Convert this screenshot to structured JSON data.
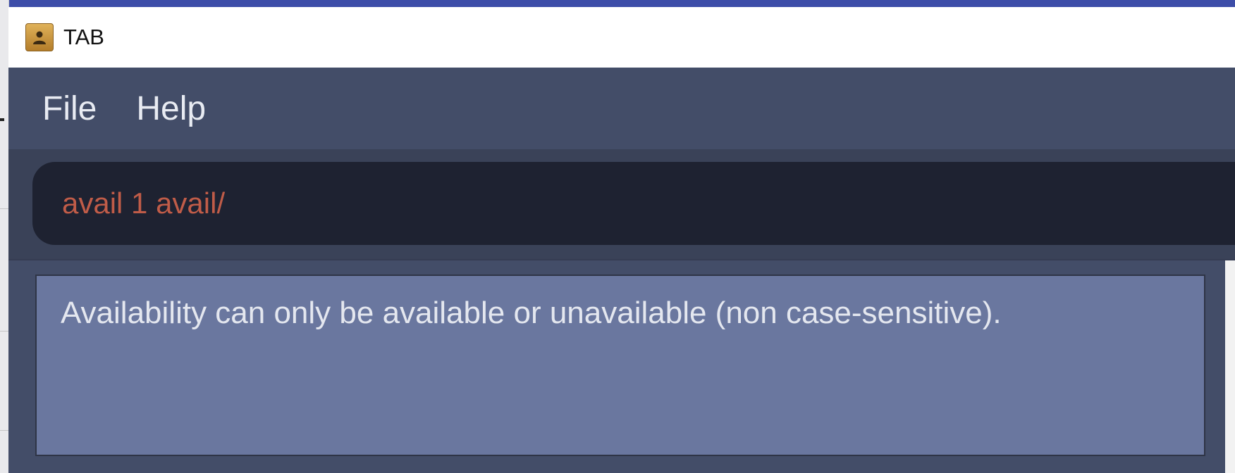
{
  "window": {
    "title": "TAB",
    "icon": "address-book-icon"
  },
  "menu": {
    "items": [
      {
        "label": "File"
      },
      {
        "label": "Help"
      }
    ]
  },
  "command_box": {
    "value": "avail 1 avail/"
  },
  "result_display": {
    "text": "Availability can only be available or unavailable (non case-sensitive)."
  },
  "colors": {
    "menubar": "#434d68",
    "command_bg": "#1e2231",
    "command_text": "#c05c48",
    "result_bg": "#6a779f"
  }
}
